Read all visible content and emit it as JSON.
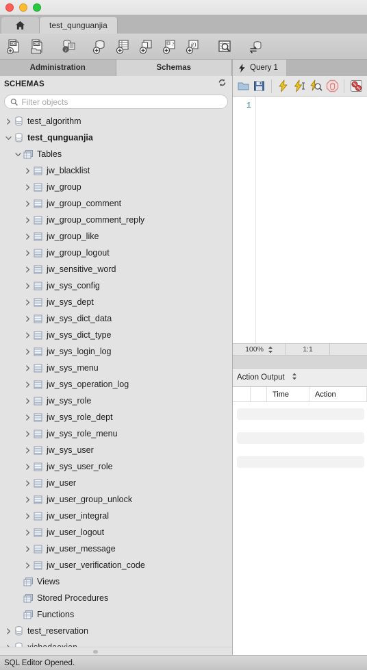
{
  "window": {
    "traffic_lights": [
      "close",
      "minimize",
      "maximize"
    ]
  },
  "main_tabs": {
    "home_label": "",
    "home_icon": "home-icon",
    "items": [
      {
        "label": "test_qunguanjia",
        "active": true
      }
    ]
  },
  "toolbar": {
    "buttons": [
      {
        "name": "new-sql-tab-icon",
        "title": "New SQL Tab"
      },
      {
        "name": "open-sql-script-icon",
        "title": "Open SQL Script"
      },
      {
        "name": "inspector-icon",
        "title": "Schema Inspector"
      },
      {
        "name": "create-schema-icon",
        "title": "Create New Schema"
      },
      {
        "name": "create-table-icon",
        "title": "Create New Table"
      },
      {
        "name": "create-view-icon",
        "title": "Create New View"
      },
      {
        "name": "create-procedure-icon",
        "title": "Create New Stored Procedure"
      },
      {
        "name": "create-function-icon",
        "title": "Create New Function"
      },
      {
        "name": "search-data-icon",
        "title": "Search Table Data"
      },
      {
        "name": "reconnect-server-icon",
        "title": "Reconnect to Server"
      }
    ]
  },
  "sidebar": {
    "tabs": [
      {
        "label": "Administration",
        "active": false
      },
      {
        "label": "Schemas",
        "active": true
      }
    ],
    "header": {
      "title": "SCHEMAS",
      "refresh_icon": "refresh-icon"
    },
    "filter": {
      "placeholder": "Filter objects",
      "value": "",
      "icon": "search-icon"
    },
    "tree": [
      {
        "label": "test_algorithm",
        "depth": 0,
        "expander": "collapsed",
        "icon": "schema-icon",
        "bold": false
      },
      {
        "label": "test_qunguanjia",
        "depth": 0,
        "expander": "expanded",
        "icon": "schema-icon",
        "bold": true
      },
      {
        "label": "Tables",
        "depth": 1,
        "expander": "expanded",
        "icon": "folder-icon",
        "bold": false
      },
      {
        "label": "jw_blacklist",
        "depth": 2,
        "expander": "collapsed",
        "icon": "table-icon",
        "bold": false
      },
      {
        "label": "jw_group",
        "depth": 2,
        "expander": "collapsed",
        "icon": "table-icon",
        "bold": false
      },
      {
        "label": "jw_group_comment",
        "depth": 2,
        "expander": "collapsed",
        "icon": "table-icon",
        "bold": false
      },
      {
        "label": "jw_group_comment_reply",
        "depth": 2,
        "expander": "collapsed",
        "icon": "table-icon",
        "bold": false
      },
      {
        "label": "jw_group_like",
        "depth": 2,
        "expander": "collapsed",
        "icon": "table-icon",
        "bold": false
      },
      {
        "label": "jw_group_logout",
        "depth": 2,
        "expander": "collapsed",
        "icon": "table-icon",
        "bold": false
      },
      {
        "label": "jw_sensitive_word",
        "depth": 2,
        "expander": "collapsed",
        "icon": "table-icon",
        "bold": false
      },
      {
        "label": "jw_sys_config",
        "depth": 2,
        "expander": "collapsed",
        "icon": "table-icon",
        "bold": false
      },
      {
        "label": "jw_sys_dept",
        "depth": 2,
        "expander": "collapsed",
        "icon": "table-icon",
        "bold": false
      },
      {
        "label": "jw_sys_dict_data",
        "depth": 2,
        "expander": "collapsed",
        "icon": "table-icon",
        "bold": false
      },
      {
        "label": "jw_sys_dict_type",
        "depth": 2,
        "expander": "collapsed",
        "icon": "table-icon",
        "bold": false
      },
      {
        "label": "jw_sys_login_log",
        "depth": 2,
        "expander": "collapsed",
        "icon": "table-icon",
        "bold": false
      },
      {
        "label": "jw_sys_menu",
        "depth": 2,
        "expander": "collapsed",
        "icon": "table-icon",
        "bold": false
      },
      {
        "label": "jw_sys_operation_log",
        "depth": 2,
        "expander": "collapsed",
        "icon": "table-icon",
        "bold": false
      },
      {
        "label": "jw_sys_role",
        "depth": 2,
        "expander": "collapsed",
        "icon": "table-icon",
        "bold": false
      },
      {
        "label": "jw_sys_role_dept",
        "depth": 2,
        "expander": "collapsed",
        "icon": "table-icon",
        "bold": false
      },
      {
        "label": "jw_sys_role_menu",
        "depth": 2,
        "expander": "collapsed",
        "icon": "table-icon",
        "bold": false
      },
      {
        "label": "jw_sys_user",
        "depth": 2,
        "expander": "collapsed",
        "icon": "table-icon",
        "bold": false
      },
      {
        "label": "jw_sys_user_role",
        "depth": 2,
        "expander": "collapsed",
        "icon": "table-icon",
        "bold": false
      },
      {
        "label": "jw_user",
        "depth": 2,
        "expander": "collapsed",
        "icon": "table-icon",
        "bold": false
      },
      {
        "label": "jw_user_group_unlock",
        "depth": 2,
        "expander": "collapsed",
        "icon": "table-icon",
        "bold": false
      },
      {
        "label": "jw_user_integral",
        "depth": 2,
        "expander": "collapsed",
        "icon": "table-icon",
        "bold": false
      },
      {
        "label": "jw_user_logout",
        "depth": 2,
        "expander": "collapsed",
        "icon": "table-icon",
        "bold": false
      },
      {
        "label": "jw_user_message",
        "depth": 2,
        "expander": "collapsed",
        "icon": "table-icon",
        "bold": false
      },
      {
        "label": "jw_user_verification_code",
        "depth": 2,
        "expander": "collapsed",
        "icon": "table-icon",
        "bold": false
      },
      {
        "label": "Views",
        "depth": 1,
        "expander": "none",
        "icon": "folder-icon",
        "bold": false
      },
      {
        "label": "Stored Procedures",
        "depth": 1,
        "expander": "none",
        "icon": "folder-icon",
        "bold": false
      },
      {
        "label": "Functions",
        "depth": 1,
        "expander": "none",
        "icon": "folder-icon",
        "bold": false
      },
      {
        "label": "test_reservation",
        "depth": 0,
        "expander": "collapsed",
        "icon": "schema-icon",
        "bold": false
      },
      {
        "label": "xishadaoxian",
        "depth": 0,
        "expander": "collapsed",
        "icon": "schema-icon",
        "bold": false
      }
    ]
  },
  "editor": {
    "tab": {
      "label": "Query 1",
      "icon": "lightning-icon"
    },
    "toolbar_buttons": [
      {
        "name": "open-file-icon",
        "title": "Open a script file in this editor"
      },
      {
        "name": "save-file-icon",
        "title": "Save the script to a file"
      },
      {
        "name": "execute-icon",
        "title": "Execute the selected portion or everything"
      },
      {
        "name": "execute-statement-icon",
        "title": "Execute the statement under the keyboard cursor"
      },
      {
        "name": "explain-icon",
        "title": "Explain the statement under the cursor"
      },
      {
        "name": "stop-icon",
        "title": "Stop the query being executed"
      },
      {
        "name": "toggle-stop-on-error-icon",
        "title": "Toggle whether execution should stop on errors"
      }
    ],
    "line_numbers": [
      "1"
    ],
    "content": "",
    "zoom": "100%",
    "cursor_position": "1:1"
  },
  "output": {
    "title": "Action Output",
    "selector_icon": "stepper-icon",
    "columns": [
      "",
      "",
      "Time",
      "Action"
    ],
    "rows": []
  },
  "status_bar": {
    "message": "SQL Editor Opened."
  },
  "colors": {
    "window_bg": "#ebebeb",
    "tabstrip_bg": "#b6b6b6",
    "toolbar_bg": "#cccccc",
    "sidebar_bg": "#e3e3e3",
    "editor_bg": "#ffffff",
    "line_number": "#2e7f92",
    "traffic_red": "#ff5f57",
    "traffic_yellow": "#febc2e",
    "traffic_green": "#28c840",
    "icon_blue": "#8fa8c8",
    "icon_yellow": "#e8c13a"
  }
}
